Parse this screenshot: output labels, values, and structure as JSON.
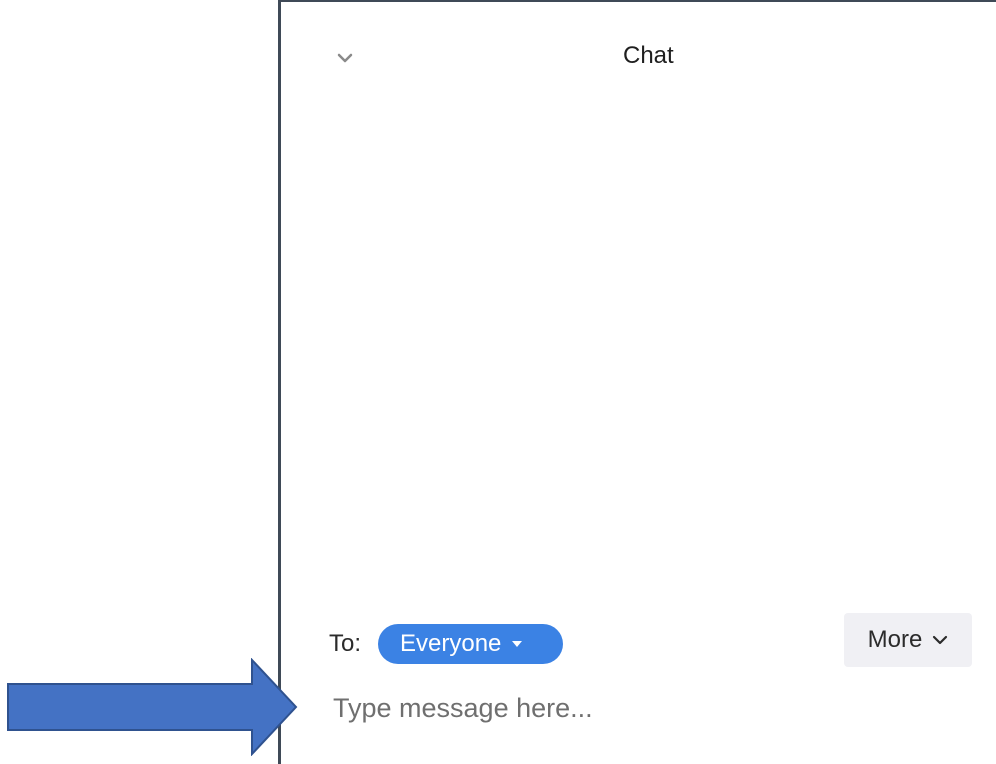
{
  "chat": {
    "title": "Chat",
    "to_label": "To:",
    "recipient": "Everyone",
    "more_label": "More",
    "input_placeholder": "Type message here..."
  },
  "colors": {
    "recipient_pill": "#3b82e4",
    "panel_border": "#3f4a57",
    "arrow": "#4472c4",
    "arrow_outline": "#2f528f",
    "more_button_bg": "#f0f0f4"
  },
  "icons": {
    "collapse": "chevron-down-icon",
    "recipient_dropdown": "caret-down-icon",
    "more_dropdown": "chevron-down-icon",
    "pointer": "arrow-right-icon"
  }
}
